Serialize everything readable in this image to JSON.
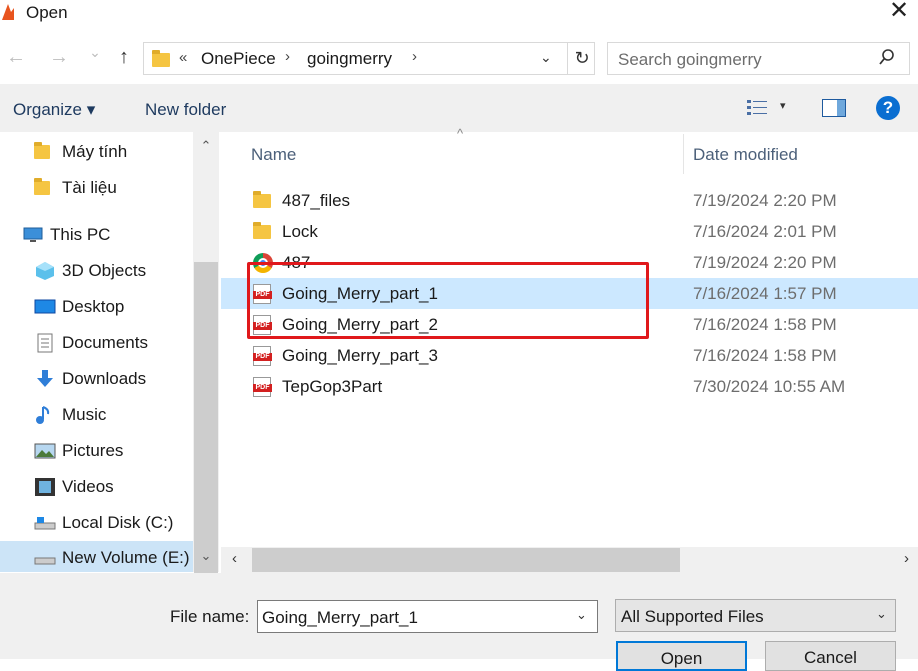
{
  "window": {
    "title": "Open",
    "close_glyph": "✕"
  },
  "nav": {
    "back": "←",
    "forward": "→",
    "recent": "⌄",
    "up": "↑"
  },
  "address": {
    "overflow": "«",
    "crumbs": [
      "OnePiece",
      "goingmerry"
    ],
    "sep": "›",
    "dropdown": "⌄",
    "refresh": "↻"
  },
  "search": {
    "placeholder": "Search goingmerry",
    "icon": "⚲"
  },
  "toolbar": {
    "organize": "Organize ▾",
    "new_folder": "New folder",
    "view_dd": "▾",
    "help": "?"
  },
  "sidebar": {
    "items": [
      {
        "label": "Máy tính",
        "icon": "folder-icon"
      },
      {
        "label": "Tài liệu",
        "icon": "folder-icon"
      },
      {
        "label": "This PC",
        "icon": "pc-icon"
      },
      {
        "label": "3D Objects",
        "icon": "cube-icon"
      },
      {
        "label": "Desktop",
        "icon": "desktop-icon"
      },
      {
        "label": "Documents",
        "icon": "document-icon"
      },
      {
        "label": "Downloads",
        "icon": "download-icon"
      },
      {
        "label": "Music",
        "icon": "music-icon"
      },
      {
        "label": "Pictures",
        "icon": "picture-icon"
      },
      {
        "label": "Videos",
        "icon": "video-icon"
      },
      {
        "label": "Local Disk (C:)",
        "icon": "drive-icon"
      },
      {
        "label": "New Volume (E:)",
        "icon": "drive-icon"
      }
    ],
    "scroll_up": "⌃",
    "scroll_down": "⌄"
  },
  "columns": {
    "name": "Name",
    "date": "Date modified",
    "sort_caret": "^"
  },
  "files": [
    {
      "name": "487_files",
      "date": "7/19/2024 2:20 PM",
      "type": "folder"
    },
    {
      "name": "Lock",
      "date": "7/16/2024 2:01 PM",
      "type": "folder"
    },
    {
      "name": "487",
      "date": "7/19/2024 2:20 PM",
      "type": "chrome"
    },
    {
      "name": "Going_Merry_part_1",
      "date": "7/16/2024 1:57 PM",
      "type": "pdf"
    },
    {
      "name": "Going_Merry_part_2",
      "date": "7/16/2024 1:58 PM",
      "type": "pdf"
    },
    {
      "name": "Going_Merry_part_3",
      "date": "7/16/2024 1:58 PM",
      "type": "pdf"
    },
    {
      "name": "TepGop3Part",
      "date": "7/30/2024 10:55 AM",
      "type": "pdf"
    }
  ],
  "pdf_badge": "PDF",
  "hscroll": {
    "left": "‹",
    "right": "›"
  },
  "footer": {
    "file_name_label": "File name:",
    "file_name_value": "Going_Merry_part_1",
    "file_name_dd": "⌄",
    "file_type_value": "All Supported Files",
    "file_type_dd": "⌄",
    "open_label": "Open",
    "cancel_label": "Cancel"
  },
  "colors": {
    "selection": "#cce8ff",
    "highlight_box": "#e0181b",
    "accent": "#0078d7"
  }
}
